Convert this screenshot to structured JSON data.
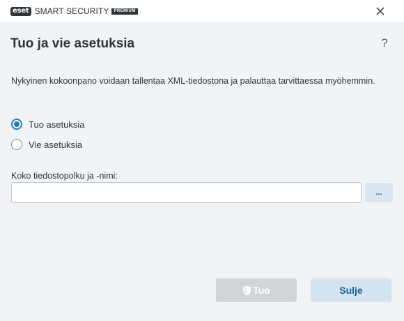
{
  "titlebar": {
    "brand": "eset",
    "product": "SMART SECURITY",
    "edition": "PREMIUM",
    "close_icon": "close-icon"
  },
  "page": {
    "title": "Tuo ja vie asetuksia",
    "help_label": "?",
    "description": "Nykyinen kokoonpano voidaan tallentaa XML-tiedostona ja palauttaa tarvittaessa myöhemmin."
  },
  "options": {
    "selected": "import",
    "import_label": "Tuo asetuksia",
    "export_label": "Vie asetuksia"
  },
  "path": {
    "label": "Koko tiedostopolku ja -nimi:",
    "value": "",
    "browse_label": "..."
  },
  "buttons": {
    "import_label": "Tuo",
    "import_icon": "shield-icon",
    "close_label": "Sulje"
  },
  "colors": {
    "accent": "#1b7cc5",
    "background": "#f2f3f4"
  }
}
